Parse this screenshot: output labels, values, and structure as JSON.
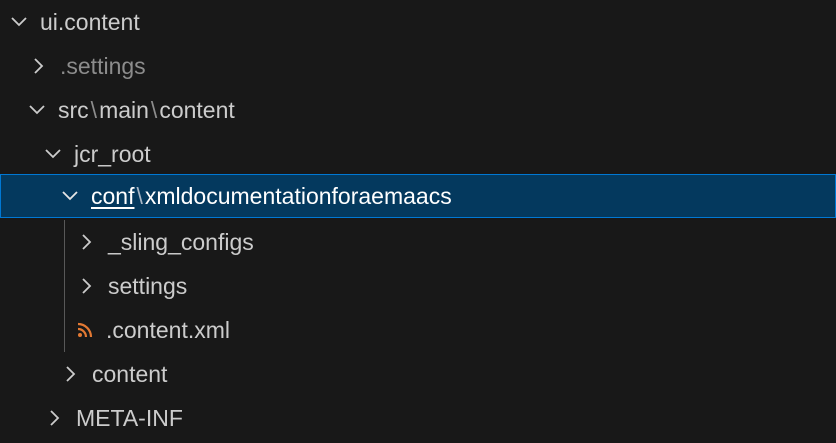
{
  "explorer": {
    "items": [
      {
        "label": "ui.content",
        "expanded": true
      },
      {
        "label": ".settings",
        "expanded": false
      },
      {
        "segments": [
          "src",
          "main",
          "content"
        ],
        "separator": "\\",
        "expanded": true
      },
      {
        "label": "jcr_root",
        "expanded": true
      },
      {
        "segments": [
          "conf",
          "xmldocumentationforaemaacs"
        ],
        "separator": "\\",
        "expanded": true,
        "selected": true
      },
      {
        "label": "_sling_configs",
        "expanded": false
      },
      {
        "label": "settings",
        "expanded": false
      },
      {
        "label": ".content.xml",
        "icon": "rss-feed-icon"
      },
      {
        "label": "content",
        "expanded": false
      },
      {
        "label": "META-INF",
        "expanded": false
      }
    ]
  },
  "colors": {
    "background": "#181818",
    "selection": "#04395e",
    "focus_border": "#0078d4",
    "text": "#cccccc",
    "dim_text": "#8c8c8c",
    "xml_icon": "#e37933"
  }
}
